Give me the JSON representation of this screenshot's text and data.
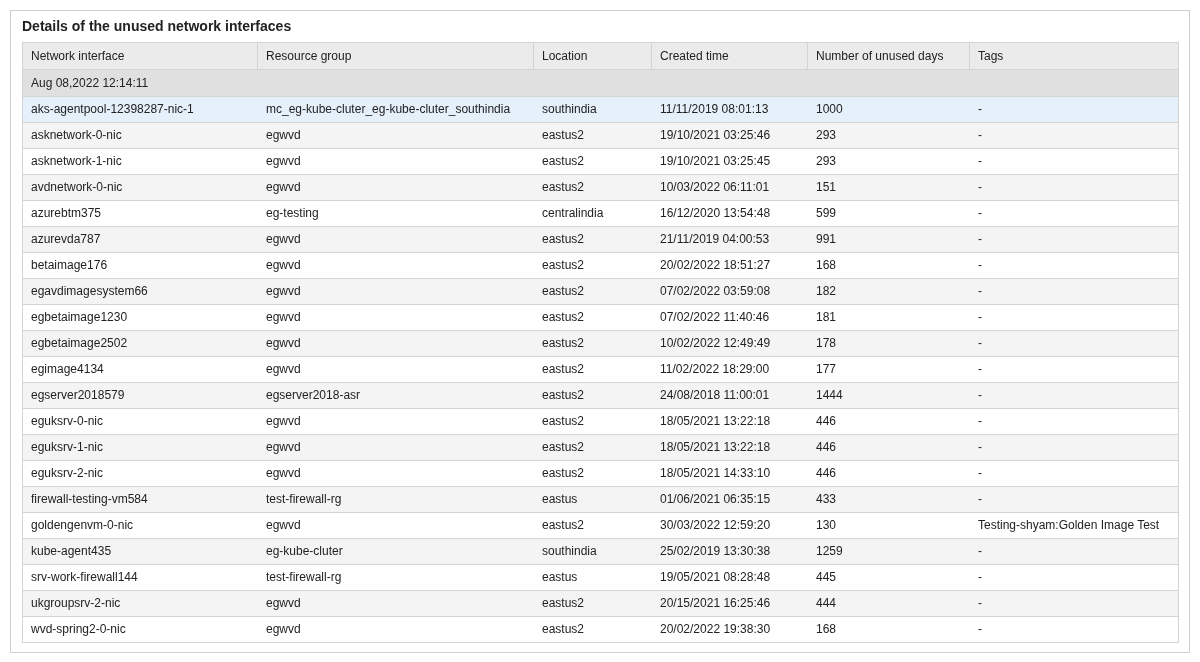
{
  "panel": {
    "title": "Details of the unused network interfaces"
  },
  "table": {
    "columns": [
      "Network interface",
      "Resource group",
      "Location",
      "Created time",
      "Number of unused days",
      "Tags"
    ],
    "group": "Aug 08,2022 12:14:11",
    "rows": [
      {
        "cells": [
          "aks-agentpool-12398287-nic-1",
          "mc_eg-kube-cluter_eg-kube-cluter_southindia",
          "southindia",
          "11/11/2019 08:01:13",
          "1000",
          "-"
        ],
        "selected": true
      },
      {
        "cells": [
          "asknetwork-0-nic",
          "egwvd",
          "eastus2",
          "19/10/2021 03:25:46",
          "293",
          "-"
        ],
        "selected": false
      },
      {
        "cells": [
          "asknetwork-1-nic",
          "egwvd",
          "eastus2",
          "19/10/2021 03:25:45",
          "293",
          "-"
        ],
        "selected": false
      },
      {
        "cells": [
          "avdnetwork-0-nic",
          "egwvd",
          "eastus2",
          "10/03/2022 06:11:01",
          "151",
          "-"
        ],
        "selected": false
      },
      {
        "cells": [
          "azurebtm375",
          "eg-testing",
          "centralindia",
          "16/12/2020 13:54:48",
          "599",
          "-"
        ],
        "selected": false
      },
      {
        "cells": [
          "azurevda787",
          "egwvd",
          "eastus2",
          "21/11/2019 04:00:53",
          "991",
          "-"
        ],
        "selected": false
      },
      {
        "cells": [
          "betaimage176",
          "egwvd",
          "eastus2",
          "20/02/2022 18:51:27",
          "168",
          "-"
        ],
        "selected": false
      },
      {
        "cells": [
          "egavdimagesystem66",
          "egwvd",
          "eastus2",
          "07/02/2022 03:59:08",
          "182",
          "-"
        ],
        "selected": false
      },
      {
        "cells": [
          "egbetaimage1230",
          "egwvd",
          "eastus2",
          "07/02/2022 11:40:46",
          "181",
          "-"
        ],
        "selected": false
      },
      {
        "cells": [
          "egbetaimage2502",
          "egwvd",
          "eastus2",
          "10/02/2022 12:49:49",
          "178",
          "-"
        ],
        "selected": false
      },
      {
        "cells": [
          "egimage4134",
          "egwvd",
          "eastus2",
          "11/02/2022 18:29:00",
          "177",
          "-"
        ],
        "selected": false
      },
      {
        "cells": [
          "egserver2018579",
          "egserver2018-asr",
          "eastus2",
          "24/08/2018 11:00:01",
          "1444",
          "-"
        ],
        "selected": false
      },
      {
        "cells": [
          "eguksrv-0-nic",
          "egwvd",
          "eastus2",
          "18/05/2021 13:22:18",
          "446",
          "-"
        ],
        "selected": false
      },
      {
        "cells": [
          "eguksrv-1-nic",
          "egwvd",
          "eastus2",
          "18/05/2021 13:22:18",
          "446",
          "-"
        ],
        "selected": false
      },
      {
        "cells": [
          "eguksrv-2-nic",
          "egwvd",
          "eastus2",
          "18/05/2021 14:33:10",
          "446",
          "-"
        ],
        "selected": false
      },
      {
        "cells": [
          "firewall-testing-vm584",
          "test-firewall-rg",
          "eastus",
          "01/06/2021 06:35:15",
          "433",
          "-"
        ],
        "selected": false
      },
      {
        "cells": [
          "goldengenvm-0-nic",
          "egwvd",
          "eastus2",
          "30/03/2022 12:59:20",
          "130",
          "Testing-shyam:Golden Image Test"
        ],
        "selected": false
      },
      {
        "cells": [
          "kube-agent435",
          "eg-kube-cluter",
          "southindia",
          "25/02/2019 13:30:38",
          "1259",
          "-"
        ],
        "selected": false
      },
      {
        "cells": [
          "srv-work-firewall144",
          "test-firewall-rg",
          "eastus",
          "19/05/2021 08:28:48",
          "445",
          "-"
        ],
        "selected": false
      },
      {
        "cells": [
          "ukgroupsrv-2-nic",
          "egwvd",
          "eastus2",
          "20/15/2021 16:25:46",
          "444",
          "-"
        ],
        "selected": false
      },
      {
        "cells": [
          "wvd-spring2-0-nic",
          "egwvd",
          "eastus2",
          "20/02/2022 19:38:30",
          "168",
          "-"
        ],
        "selected": false
      }
    ]
  }
}
